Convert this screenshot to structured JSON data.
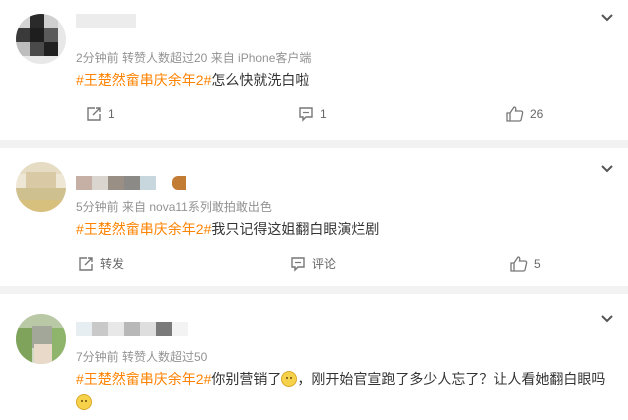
{
  "comments": [
    {
      "meta": "2分钟前  转赞人数超过20  来自 iPhone客户端",
      "topic": "#王楚然畲串庆余年2#",
      "text": "怎么快就洗白啦",
      "actions": {
        "repost_count": "1",
        "comment_count": "1",
        "like_count": "26"
      }
    },
    {
      "meta": "5分钟前  来自 nova11系列敢拍敢出色",
      "topic": "#王楚然畲串庆余年2#",
      "text": "我只记得这姐翻白眼演烂剧",
      "actions": {
        "repost_label": "转发",
        "comment_label": "评论",
        "like_count": "5"
      }
    },
    {
      "meta": "7分钟前  转赞人数超过50",
      "topic": "#王楚然畲串庆余年2#",
      "text_a": "你别营销了",
      "text_b": "，刚开始官宣跑了多少人忘了？让人看她翻白眼吗"
    }
  ],
  "icons": [
    "chevron-down-icon",
    "repost-icon",
    "comment-icon",
    "like-icon",
    "emoji-icon"
  ],
  "colors": {
    "topic": "#ff8200",
    "meta": "#939393",
    "divider": "#f2f2f2"
  }
}
